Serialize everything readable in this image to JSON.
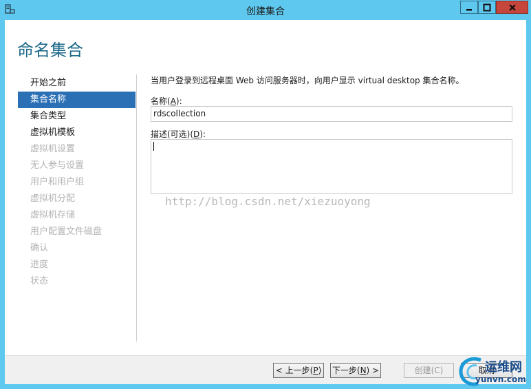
{
  "window": {
    "title": "创建集合",
    "icon": "server-app-icon"
  },
  "page": {
    "heading": "命名集合",
    "description": "当用户登录到远程桌面 Web 访问服务器时，向用户显示 virtual desktop 集合名称。"
  },
  "nav": {
    "items": [
      {
        "label": "开始之前",
        "state": "normal"
      },
      {
        "label": "集合名称",
        "state": "active"
      },
      {
        "label": "集合类型",
        "state": "normal"
      },
      {
        "label": "虚拟机模板",
        "state": "normal"
      },
      {
        "label": "虚拟机设置",
        "state": "disabled"
      },
      {
        "label": "无人参与设置",
        "state": "disabled"
      },
      {
        "label": "用户和用户组",
        "state": "disabled"
      },
      {
        "label": "虚拟机分配",
        "state": "disabled"
      },
      {
        "label": "虚拟机存储",
        "state": "disabled"
      },
      {
        "label": "用户配置文件磁盘",
        "state": "disabled"
      },
      {
        "label": "确认",
        "state": "disabled"
      },
      {
        "label": "进度",
        "state": "disabled"
      },
      {
        "label": "状态",
        "state": "disabled"
      }
    ]
  },
  "form": {
    "name_label_prefix": "名称(",
    "name_label_key": "A",
    "name_label_suffix": "):",
    "name_value": "rdscollection",
    "desc_label_prefix": "描述(可选)(",
    "desc_label_key": "D",
    "desc_label_suffix": "):",
    "desc_value": ""
  },
  "watermark": "http://blog.csdn.net/xiezuoyong",
  "footer": {
    "prev": {
      "prefix": "< 上一步(",
      "key": "P",
      "suffix": ")"
    },
    "next": {
      "prefix": "下一步(",
      "key": "N",
      "suffix": ") >"
    },
    "create": "创建(C)",
    "cancel": "取消"
  },
  "logo": {
    "cn": "运维网",
    "en": "yunvn.com"
  },
  "colors": {
    "frame": "#5fc8ee",
    "accent_heading": "#1e6a8a",
    "nav_active": "#2b6fb5",
    "close_button": "#c7463b"
  }
}
